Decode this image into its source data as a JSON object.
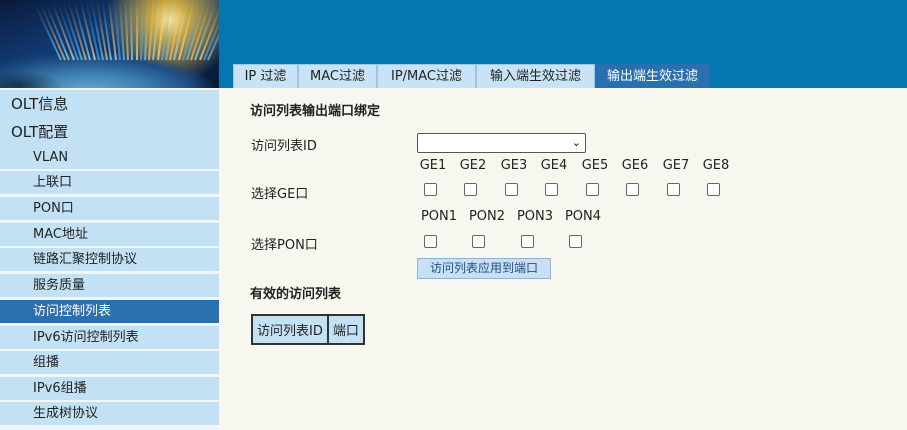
{
  "tabs": [
    {
      "label": "IP 过滤",
      "active": false
    },
    {
      "label": "MAC过滤",
      "active": false
    },
    {
      "label": "IP/MAC过滤",
      "active": false
    },
    {
      "label": "输入端生效过滤",
      "active": false
    },
    {
      "label": "输出端生效过滤",
      "active": true
    }
  ],
  "sidebar": {
    "items": [
      {
        "label": "OLT信息",
        "level": "top",
        "active": false
      },
      {
        "label": "OLT配置",
        "level": "top",
        "active": false
      },
      {
        "label": "VLAN",
        "level": "sub",
        "active": false
      },
      {
        "label": "上联口",
        "level": "sub",
        "active": false
      },
      {
        "label": "PON口",
        "level": "sub",
        "active": false
      },
      {
        "label": "MAC地址",
        "level": "sub",
        "active": false
      },
      {
        "label": "链路汇聚控制协议",
        "level": "sub",
        "active": false
      },
      {
        "label": "服务质量",
        "level": "sub",
        "active": false
      },
      {
        "label": "访问控制列表",
        "level": "sub",
        "active": true
      },
      {
        "label": "IPv6访问控制列表",
        "level": "sub",
        "active": false
      },
      {
        "label": "组播",
        "level": "sub",
        "active": false
      },
      {
        "label": "IPv6组播",
        "level": "sub",
        "active": false
      },
      {
        "label": "生成树协议",
        "level": "sub",
        "active": false
      }
    ]
  },
  "form": {
    "title": "访问列表输出端口绑定",
    "acl_id_label": "访问列表ID",
    "acl_id_value": "",
    "ge_label": "选择GE口",
    "ge_ports": [
      "GE1",
      "GE2",
      "GE3",
      "GE4",
      "GE5",
      "GE6",
      "GE7",
      "GE8"
    ],
    "ge_checked": [
      false,
      false,
      false,
      false,
      false,
      false,
      false,
      false
    ],
    "pon_label": "选择PON口",
    "pon_ports": [
      "PON1",
      "PON2",
      "PON3",
      "PON4"
    ],
    "pon_checked": [
      false,
      false,
      false,
      false
    ],
    "apply_button": "访问列表应用到端口"
  },
  "effective": {
    "title": "有效的访问列表",
    "columns": [
      "访问列表ID",
      "端口"
    ]
  },
  "colors": {
    "banner": "#0576b0",
    "tab_bg": "#c7e3f5",
    "active_bg": "#2a6fae",
    "nav_bg": "#c3e1f4",
    "content_bg": "#f7f7ef"
  }
}
